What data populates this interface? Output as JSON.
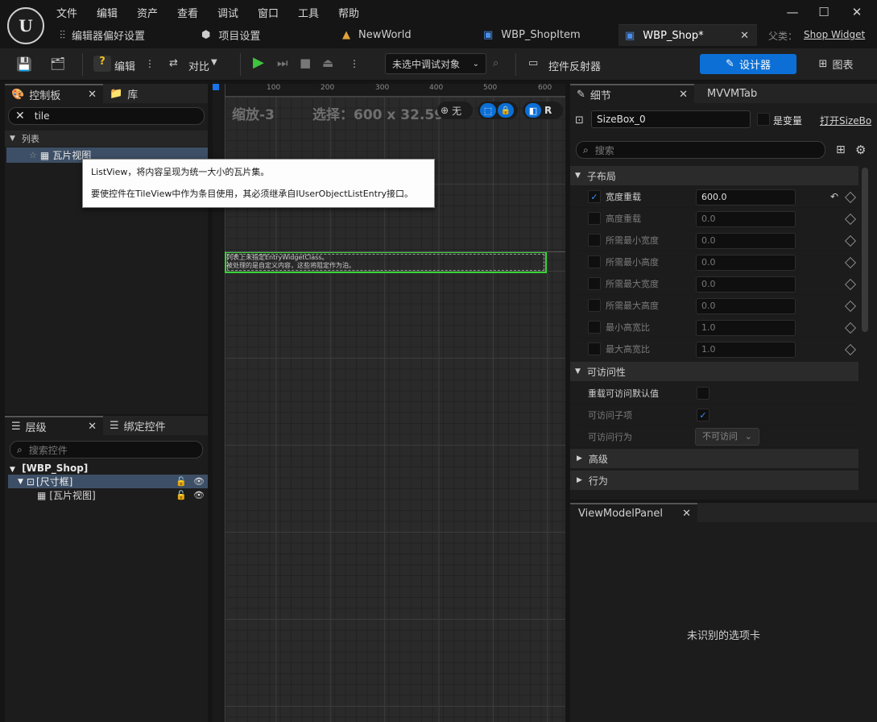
{
  "menu": [
    "文件",
    "编辑",
    "资产",
    "查看",
    "调试",
    "窗口",
    "工具",
    "帮助"
  ],
  "tabs": [
    {
      "label": "编辑器偏好设置",
      "icon": "sliders-icon"
    },
    {
      "label": "项目设置",
      "icon": "cube-icon"
    },
    {
      "label": "NewWorld",
      "icon": "level-icon"
    },
    {
      "label": "WBP_ShopItem",
      "icon": "widget-blueprint-icon"
    },
    {
      "label": "WBP_Shop*",
      "icon": "widget-blueprint-icon"
    }
  ],
  "parent": {
    "label": "父类：",
    "value": "Shop Widget"
  },
  "toolbar": {
    "compile": "编辑",
    "diff": "对比",
    "debug_target": "未选中调试对象",
    "reflector": "控件反射器",
    "designer": "设计器",
    "graph": "图表"
  },
  "palette": {
    "tab": "控制板",
    "tab2": "库",
    "search": "tile",
    "category": "列表",
    "item": "瓦片视图"
  },
  "tooltip": {
    "line1": "ListView，将内容呈现为统一大小的瓦片集。",
    "line2": "要使控件在TileView中作为条目使用，其必须继承自IUserObjectListEntry接口。"
  },
  "hierarchy": {
    "tab": "层级",
    "tab2": "绑定控件",
    "search_placeholder": "搜索控件",
    "root": "[WBP_Shop]",
    "child": "[尺寸框]",
    "leaf": "[瓦片视图]"
  },
  "canvas": {
    "zoom": "缩放-3",
    "selection": "选择：600 x 32.59",
    "none": "无",
    "r": "R",
    "ruler_x": [
      "100",
      "200",
      "300",
      "400",
      "500",
      "600"
    ],
    "warning1": "列表上未指定EntryWidgetClass。",
    "warning2": "被处理的是自定义内容，这些将阻定作为泊。"
  },
  "details": {
    "tab": "细节",
    "tab2": "MVVMTab",
    "name": "SizeBox_0",
    "is_variable": "是变量",
    "open": "打开SizeBo",
    "search_placeholder": "搜索",
    "section_layout": "子布局",
    "rows": [
      {
        "label": "宽度重载",
        "value": "600.0",
        "checked": true
      },
      {
        "label": "高度重载",
        "value": "0.0",
        "checked": false
      },
      {
        "label": "所需最小宽度",
        "value": "0.0",
        "checked": false
      },
      {
        "label": "所需最小高度",
        "value": "0.0",
        "checked": false
      },
      {
        "label": "所需最大宽度",
        "value": "0.0",
        "checked": false
      },
      {
        "label": "所需最大高度",
        "value": "0.0",
        "checked": false
      },
      {
        "label": "最小高宽比",
        "value": "1.0",
        "checked": false
      },
      {
        "label": "最大高宽比",
        "value": "1.0",
        "checked": false
      }
    ],
    "section_access": "可访问性",
    "access_override": "重载可访问默认值",
    "access_children": "可访问子项",
    "access_behavior": "可访问行为",
    "access_behavior_value": "不可访问",
    "section_advanced": "高级",
    "section_behavior": "行为"
  },
  "viewmodel": {
    "tab": "ViewModelPanel",
    "message": "未识别的选项卡"
  }
}
